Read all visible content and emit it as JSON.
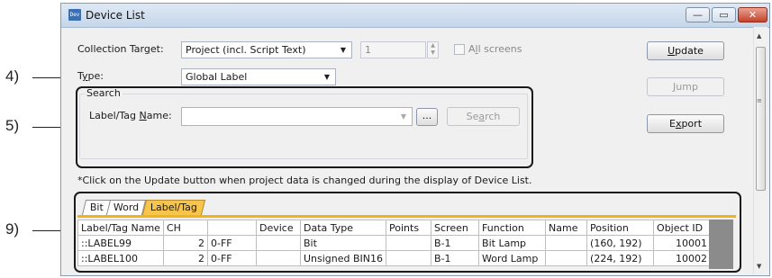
{
  "window": {
    "title": "Device List",
    "icon": "device-list-app-icon",
    "icon_text": "Dev"
  },
  "window_controls": {
    "minimize": "—",
    "maximize": "▭",
    "close": "✕"
  },
  "callouts": {
    "type": "4)",
    "search": "5)",
    "table": "9)"
  },
  "collection_target": {
    "label_pre": "Collection Tar",
    "label_key": "g",
    "label_post": "et:",
    "value": "Project (incl. Script Text)"
  },
  "screen_number": {
    "value": "1"
  },
  "all_screens": {
    "label_pre": "A",
    "label_key": "l",
    "label_post": "l screens",
    "checked": false
  },
  "type": {
    "label_pre": "T",
    "label_key": "y",
    "label_post": "pe:",
    "value": "Global Label"
  },
  "search": {
    "group_title": "Search",
    "name_label_pre": "Label/Tag ",
    "name_label_key": "N",
    "name_label_post": "ame:",
    "name_value": "",
    "browse_button": "...",
    "search_button_pre": "Se",
    "search_button_key": "a",
    "search_button_post": "rch"
  },
  "buttons": {
    "update_key": "U",
    "update_rest": "pdate",
    "jump_key": "J",
    "jump_rest": "ump",
    "export_pre": "E",
    "export_key": "x",
    "export_post": "port"
  },
  "note": "*Click on the Update button when project data is changed during the display of Device List.",
  "tabs": [
    {
      "label": "Bit",
      "active": false
    },
    {
      "label": "Word",
      "active": false
    },
    {
      "label": "Label/Tag",
      "active": true
    }
  ],
  "table": {
    "columns": [
      "Label/Tag Name",
      "CH",
      "",
      "Device",
      "Data Type",
      "Points",
      "Screen",
      "Function",
      "Name",
      "Position",
      "Object ID"
    ],
    "rows": [
      [
        "::LABEL99",
        "2",
        "0-FF",
        "",
        "Bit",
        "",
        "B-1",
        "Bit Lamp",
        "",
        "(160, 192)",
        "10001"
      ],
      [
        "::LABEL100",
        "2",
        "0-FF",
        "",
        "Unsigned BIN16",
        "",
        "B-1",
        "Word Lamp",
        "",
        "(224, 192)",
        "10002"
      ]
    ]
  },
  "colors": {
    "active_tab": "#f7c44c",
    "tab_underline": "#f2b21c",
    "titlebar": "#c5d6ea",
    "close_button": "#c4422b"
  },
  "scrollbar": {
    "up_arrow": "▲",
    "down_arrow": "▼",
    "grip": "≡"
  }
}
